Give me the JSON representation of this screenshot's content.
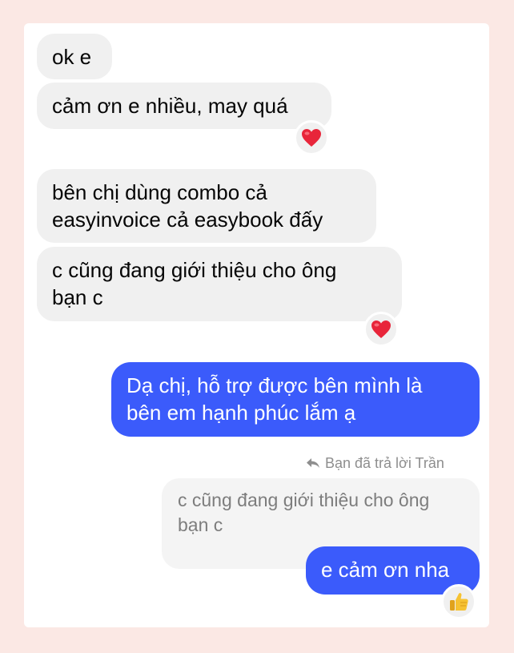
{
  "messages": {
    "m1": "ok e",
    "m2": "cảm ơn e nhiều, may quá",
    "m3_line1": "bên chị dùng combo cả",
    "m3_line2": "easyinvoice cả easybook đấy",
    "m4_line1": "c cũng đang giới thiệu cho ông",
    "m4_line2": "bạn c",
    "m5_line1": "Dạ chị, hỗ trợ được bên mình là",
    "m5_line2": "bên em hạnh phúc lắm ạ",
    "m6": "e cảm ơn nha"
  },
  "reply": {
    "note": "Bạn đã trả lời Trần",
    "quoted_line1": "c cũng đang giới thiệu cho ông",
    "quoted_line2": "bạn c"
  },
  "reactions": {
    "r1": "heart-icon",
    "r2": "heart-icon",
    "r3": "thumbs-up-icon"
  },
  "colors": {
    "outgoing": "#3b5bfb",
    "incoming": "#f0f0f0",
    "heart": "#e8253a",
    "background": "#fbe8e4"
  }
}
